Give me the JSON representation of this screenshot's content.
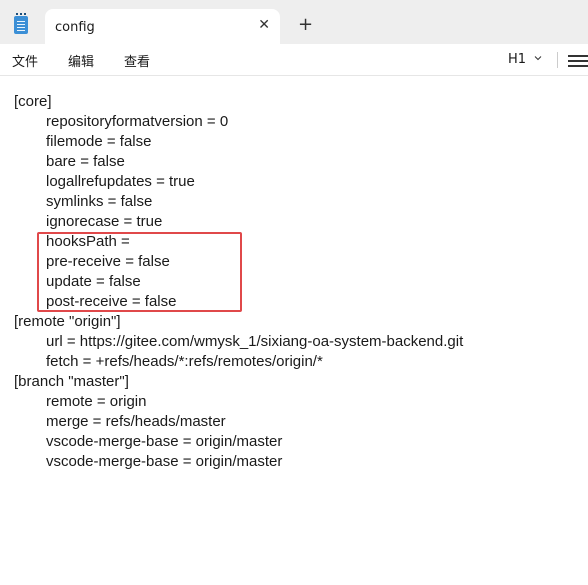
{
  "tab": {
    "title": "config",
    "close_glyph": "✕",
    "new_tab_glyph": "+"
  },
  "menu": {
    "file": "文件",
    "edit": "编辑",
    "view": "查看",
    "heading_level": "H1"
  },
  "editor": {
    "lines": [
      "[core]",
      "repositoryformatversion = 0",
      "filemode = false",
      "bare = false",
      "logallrefupdates = true",
      "symlinks = false",
      "ignorecase = true",
      "hooksPath =",
      "pre-receive = false",
      "update = false",
      "post-receive = false",
      "[remote \"origin\"]",
      "url = https://gitee.com/wmysk_1/sixiang-oa-system-backend.git",
      "fetch = +refs/heads/*:refs/remotes/origin/*",
      "[branch \"master\"]",
      "remote = origin",
      "merge = refs/heads/master",
      "vscode-merge-base = origin/master",
      "vscode-merge-base = origin/master"
    ]
  },
  "colors": {
    "highlight_box": "#e0484a",
    "app_icon": "#3b8fd6",
    "tabbar_bg": "#eeeeee"
  },
  "icons": [
    "notepad-icon",
    "close-icon",
    "plus-icon",
    "chevron-down-icon",
    "list-icon"
  ]
}
